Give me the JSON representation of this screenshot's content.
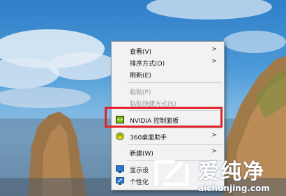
{
  "context_menu": {
    "items": [
      {
        "label": "查看(V)",
        "has_submenu": true,
        "disabled": false
      },
      {
        "label": "排序方式(O)",
        "has_submenu": true,
        "disabled": false
      },
      {
        "label": "刷新(E)",
        "has_submenu": false,
        "disabled": false
      },
      {
        "label": "粘贴(P)",
        "has_submenu": false,
        "disabled": true
      },
      {
        "label": "粘贴快捷方式(S)",
        "has_submenu": false,
        "disabled": true
      },
      {
        "label": "NVIDIA 控制面板",
        "has_submenu": false,
        "disabled": false,
        "icon": "nvidia-icon"
      },
      {
        "label": "360桌面助手",
        "has_submenu": true,
        "disabled": false,
        "icon": "360-icon"
      },
      {
        "label": "新建(W)",
        "has_submenu": true,
        "disabled": false
      },
      {
        "label": "显示设",
        "has_submenu": false,
        "disabled": false,
        "icon": "display-icon"
      },
      {
        "label": "个性化",
        "has_submenu": false,
        "disabled": false,
        "icon": "personalize-icon"
      }
    ]
  },
  "watermark": {
    "title": "爱纯净",
    "url": "aichunjing.com"
  },
  "colors": {
    "highlight_border": "#e0232a",
    "menu_bg": "#f2f2f2"
  }
}
